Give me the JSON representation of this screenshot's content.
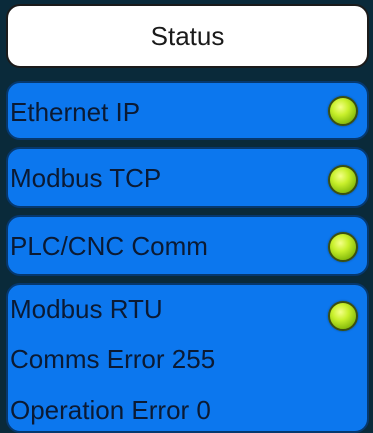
{
  "header": {
    "title": "Status"
  },
  "panels": [
    {
      "label": "Ethernet IP",
      "indicator_color": "#b7e91e"
    },
    {
      "label": "Modbus TCP",
      "indicator_color": "#b7e91e"
    },
    {
      "label": "PLC/CNC Comm",
      "indicator_color": "#b7e91e"
    },
    {
      "label": "Modbus RTU",
      "indicator_color": "#b7e91e",
      "comms_error": "Comms Error 255",
      "operation_error": "Operation Error 0"
    }
  ],
  "colors": {
    "panel_background": "#0c77ee",
    "header_background": "#ffffff",
    "page_background": "#0a2a3a"
  }
}
